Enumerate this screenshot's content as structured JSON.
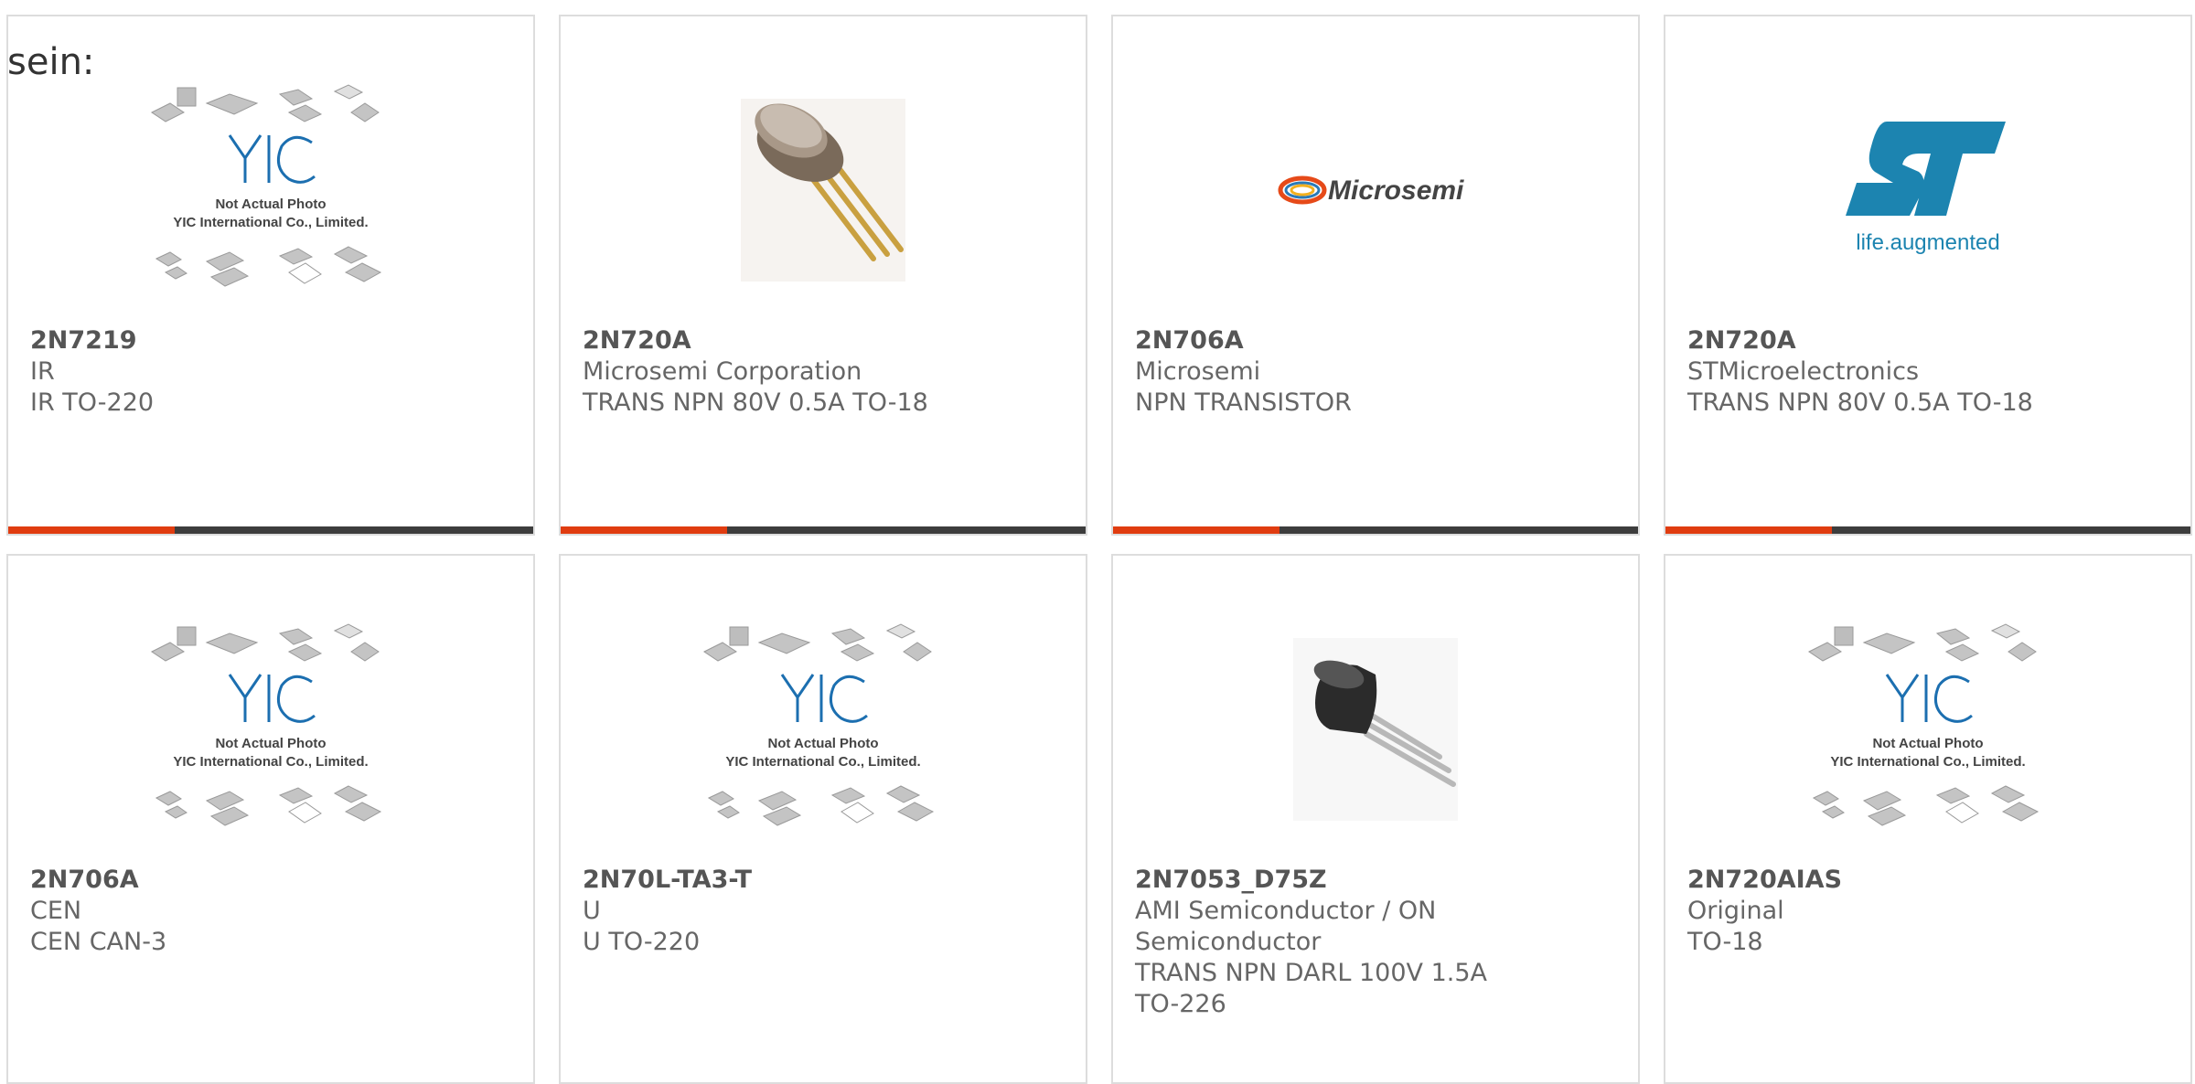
{
  "heading": "sein:",
  "colors": {
    "accent": "#e03c10",
    "bar": "#3d3d3d",
    "border": "#dddddd",
    "st_blue": "#1c84b0"
  },
  "placeholder": {
    "caption_line1": "Not Actual Photo",
    "caption_line2": "YIC International Co., Limited.",
    "logo": "YIC"
  },
  "microsemi_logo": "Microsemi",
  "st_logo_tagline": "life.augmented",
  "products": [
    {
      "part": "2N7219",
      "manufacturer": "IR",
      "description": "IR TO-220",
      "image": "placeholder"
    },
    {
      "part": "2N720A",
      "manufacturer": "Microsemi Corporation",
      "description": "TRANS NPN 80V 0.5A TO-18",
      "image": "metal-can-transistor"
    },
    {
      "part": "2N706A",
      "manufacturer": "Microsemi",
      "description": "NPN TRANSISTOR",
      "image": "microsemi-logo"
    },
    {
      "part": "2N720A",
      "manufacturer": "STMicroelectronics",
      "description": "TRANS NPN 80V 0.5A TO-18",
      "image": "st-logo"
    },
    {
      "part": "2N706A",
      "manufacturer": "CEN",
      "description": "CEN CAN-3",
      "image": "placeholder"
    },
    {
      "part": "2N70L-TA3-T",
      "manufacturer": "U",
      "description": "U TO-220",
      "image": "placeholder"
    },
    {
      "part": "2N7053_D75Z",
      "manufacturer": "AMI Semiconductor / ON Semiconductor",
      "description": "TRANS NPN DARL 100V 1.5A TO-226",
      "image": "to92-transistor"
    },
    {
      "part": "2N720AIAS",
      "manufacturer": "Original",
      "description": "TO-18",
      "image": "placeholder"
    }
  ]
}
